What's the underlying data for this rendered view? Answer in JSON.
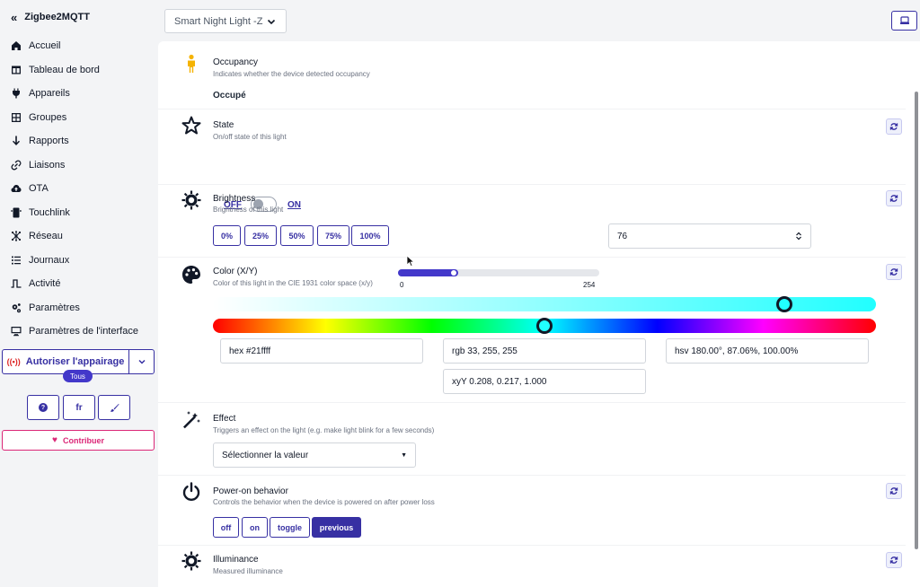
{
  "sidebar": {
    "brand": "Zigbee2MQTT",
    "items": [
      {
        "label": "Accueil",
        "icon": "home-icon"
      },
      {
        "label": "Tableau de bord",
        "icon": "dashboard-icon"
      },
      {
        "label": "Appareils",
        "icon": "plug-icon"
      },
      {
        "label": "Groupes",
        "icon": "grid-icon"
      },
      {
        "label": "Rapports",
        "icon": "arrow-down-icon"
      },
      {
        "label": "Liaisons",
        "icon": "link-icon"
      },
      {
        "label": "OTA",
        "icon": "cloud-upload-icon"
      },
      {
        "label": "Touchlink",
        "icon": "mobile-icon"
      },
      {
        "label": "Réseau",
        "icon": "network-icon"
      },
      {
        "label": "Journaux",
        "icon": "list-icon"
      },
      {
        "label": "Activité",
        "icon": "wave-icon"
      },
      {
        "label": "Paramètres",
        "icon": "cogs-icon"
      },
      {
        "label": "Paramètres de l'interface",
        "icon": "desktop-icon"
      }
    ],
    "pair_label": "Autoriser l'appairage",
    "pair_target": "Tous",
    "help_label": "?",
    "lang_label": "fr",
    "contribute_label": "Contribuer"
  },
  "topbar": {
    "device_selected": "Smart Night Light -Z"
  },
  "features": {
    "occupancy": {
      "title": "Occupancy",
      "desc": "Indicates whether the device detected occupancy",
      "value": "Occupé"
    },
    "state": {
      "title": "State",
      "desc": "On/off state of this light",
      "off_label": "OFF",
      "on_label": "ON",
      "is_on": false
    },
    "brightness": {
      "title": "Brightness",
      "desc": "Brightness of this light",
      "presets": [
        "0%",
        "25%",
        "50%",
        "75%",
        "100%"
      ],
      "min": "0",
      "max": "254",
      "value": "76",
      "fraction": 0.299
    },
    "color": {
      "title": "Color (X/Y)",
      "desc": "Color of this light in the CIE 1931 color space (x/y)",
      "hex": "hex  #21ffff",
      "rgb": "rgb  33, 255, 255",
      "hsv": "hsv  180.00°, 87.06%, 100.00%",
      "xyy": "xyY  0.208, 0.217, 1.000",
      "saturation_fraction": 0.862,
      "hue_fraction": 0.5,
      "accent": "#21ffff"
    },
    "effect": {
      "title": "Effect",
      "desc": "Triggers an effect on the light (e.g. make light blink for a few seconds)",
      "placeholder": "Sélectionner la valeur"
    },
    "power_on": {
      "title": "Power-on behavior",
      "desc": "Controls the behavior when the device is powered on after power loss",
      "options": [
        "off",
        "on",
        "toggle",
        "previous"
      ],
      "selected": "previous"
    },
    "illuminance": {
      "title": "Illuminance",
      "desc": "Measured illuminance"
    }
  },
  "colors": {
    "primary": "#3730a3",
    "contribute": "#db2777",
    "occupancy_icon": "#f5b301"
  }
}
